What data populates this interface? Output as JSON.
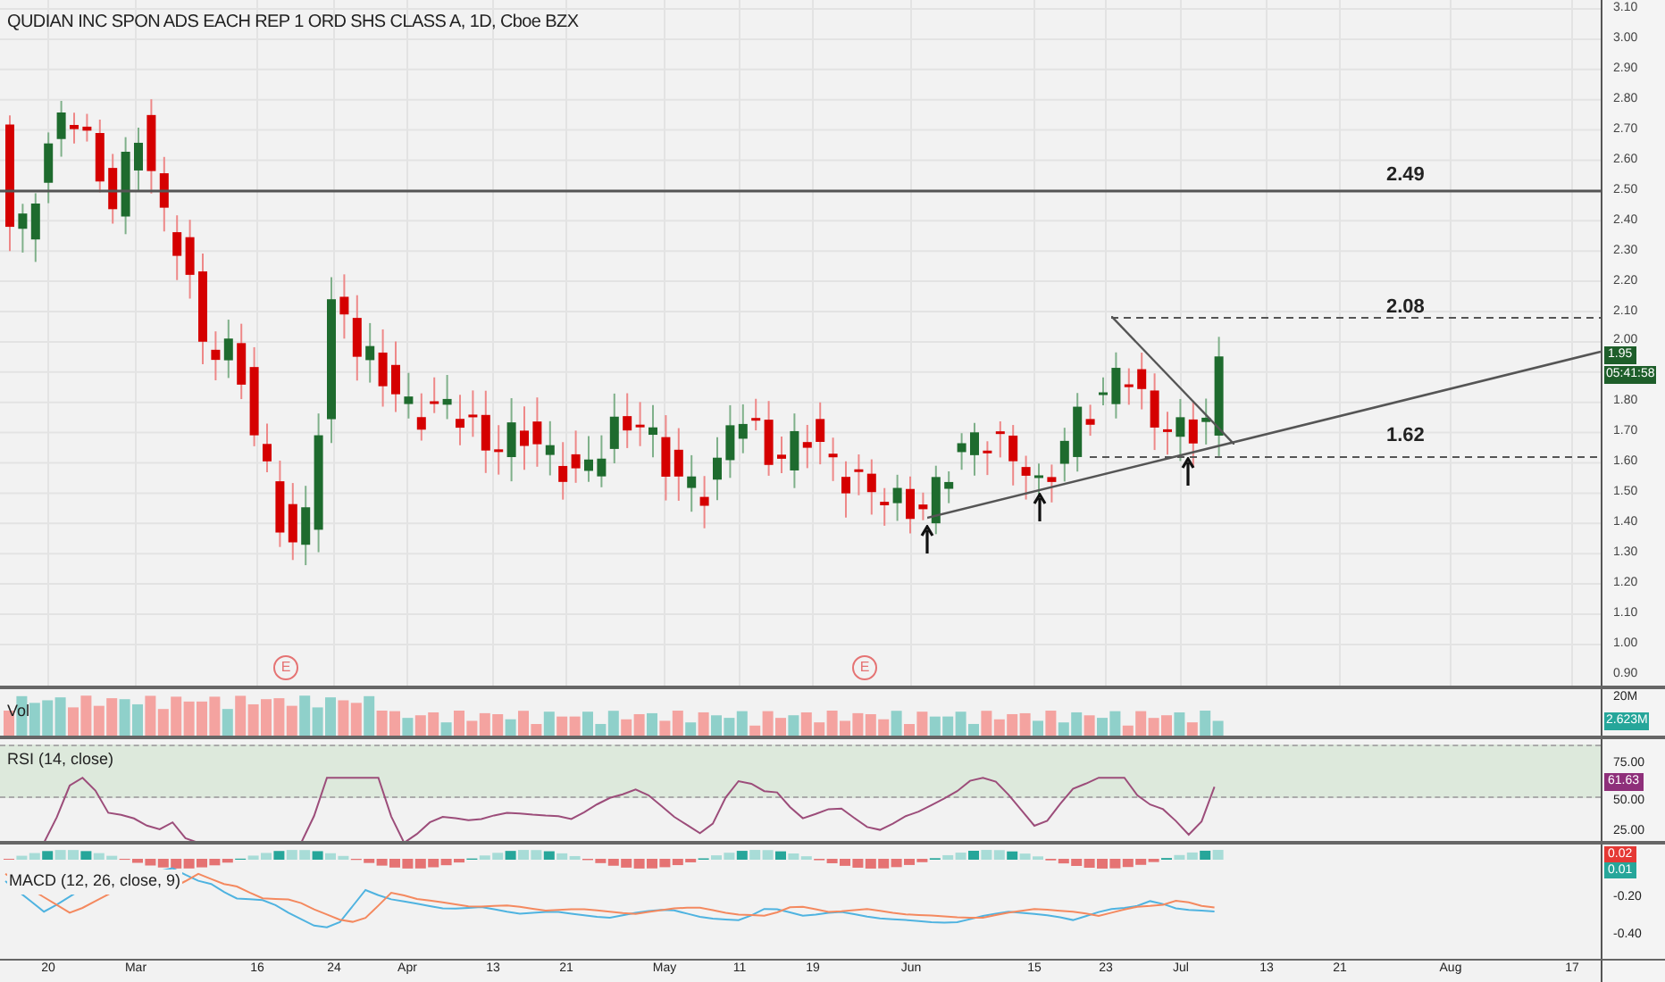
{
  "title": "QUDIAN INC SPON ADS EACH REP 1 ORD SHS CLASS A, 1D, Cboe BZX",
  "price_axis": [
    "3.10",
    "3.00",
    "2.90",
    "2.80",
    "2.70",
    "2.60",
    "2.50",
    "2.40",
    "2.30",
    "2.20",
    "2.10",
    "2.00",
    "1.80",
    "1.70",
    "1.60",
    "1.50",
    "1.40",
    "1.30",
    "1.20",
    "1.10",
    "1.00",
    "0.90"
  ],
  "price_label": "1.95",
  "countdown": "05:41:58",
  "levels": [
    {
      "label": "2.49",
      "kind": "solid"
    },
    {
      "label": "2.08",
      "kind": "dashed"
    },
    {
      "label": "1.62",
      "kind": "dashed"
    }
  ],
  "earnings_markers": [
    "E",
    "E"
  ],
  "volume": {
    "label": "Vol",
    "axis": "20M",
    "value": "2.623M"
  },
  "rsi": {
    "label": "RSI (14, close)",
    "value": "61.63",
    "ticks": [
      "75.00",
      "50.00",
      "25.00"
    ]
  },
  "macd": {
    "label": "MACD (12, 26, close, 9)",
    "values": [
      "0.02",
      "0.01"
    ],
    "ticks": [
      "-0.20",
      "-0.40"
    ]
  },
  "time_axis": [
    "20",
    "Mar",
    "16",
    "24",
    "Apr",
    "13",
    "21",
    "May",
    "11",
    "19",
    "Jun",
    "15",
    "23",
    "Jul",
    "13",
    "21",
    "Aug",
    "17"
  ]
}
